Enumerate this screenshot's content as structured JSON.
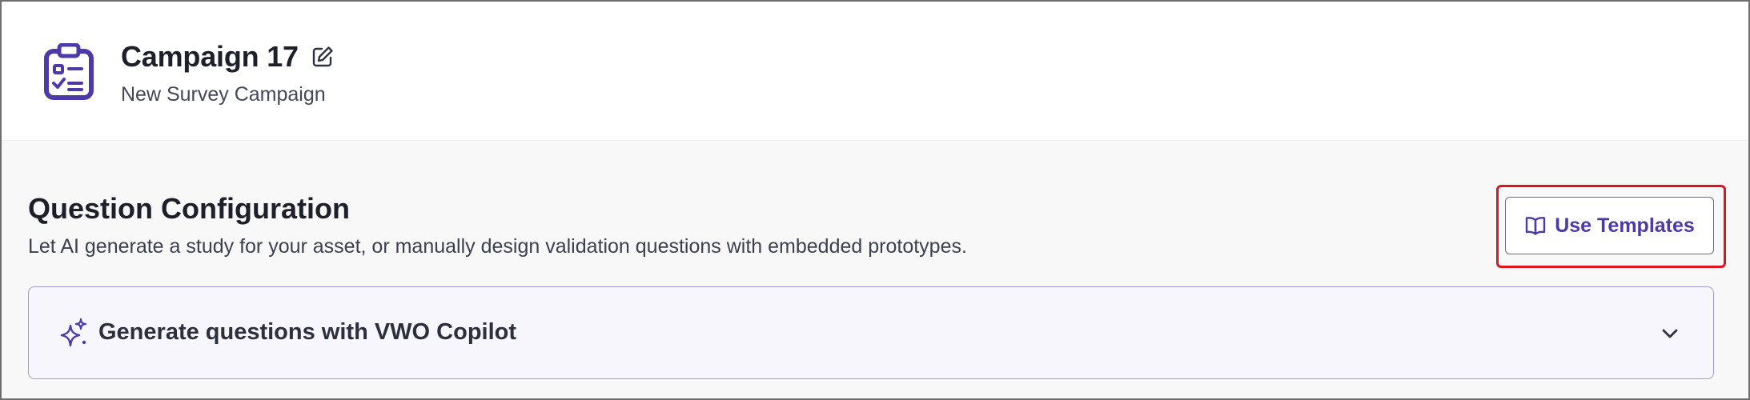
{
  "header": {
    "campaign_icon": "clipboard-checklist-icon",
    "title": "Campaign 17",
    "edit_icon": "pencil-edit-icon",
    "subtitle": "New Survey Campaign"
  },
  "section": {
    "title": "Question Configuration",
    "description": "Let AI generate a study for your asset, or manually design validation questions with embedded prototypes.",
    "templates_button": {
      "label": "Use Templates",
      "icon": "open-book-icon",
      "highlighted": true
    }
  },
  "copilot": {
    "icon": "sparkle-icon",
    "label": "Generate questions with VWO Copilot",
    "expand_icon": "chevron-down-icon",
    "expanded": false
  },
  "colors": {
    "accent": "#4b3aa8",
    "highlight_border": "#e0141e",
    "panel_border": "#a59ad9",
    "panel_bg": "#f7f6fd",
    "content_bg": "#f8f8f9"
  }
}
